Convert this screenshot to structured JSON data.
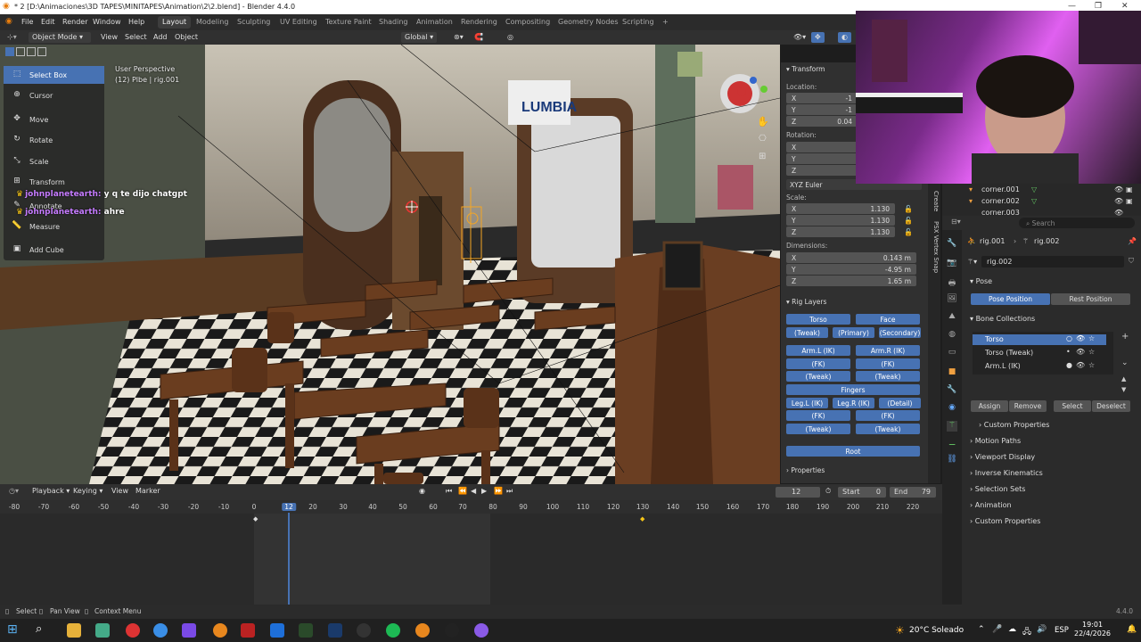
{
  "window": {
    "title": "* 2 [D:\\Animaciones\\3D TAPES\\MINITAPES\\Animation\\2\\2.blend] - Blender 4.4.0"
  },
  "menu": [
    "File",
    "Edit",
    "Render",
    "Window",
    "Help"
  ],
  "workspaces": [
    "Layout",
    "Modeling",
    "Sculpting",
    "UV Editing",
    "Texture Paint",
    "Shading",
    "Animation",
    "Rendering",
    "Compositing",
    "Geometry Nodes",
    "Scripting"
  ],
  "viewport_header": {
    "mode": "Object Mode",
    "view": "View",
    "select": "Select",
    "add": "Add",
    "object": "Object",
    "orientation": "Global"
  },
  "viewport_info": {
    "perspective": "User Perspective",
    "object": "(12) Plbe | rig.001"
  },
  "tools": [
    "Select Box",
    "Cursor",
    "Move",
    "Rotate",
    "Scale",
    "Transform",
    "Annotate",
    "Measure",
    "Add Cube"
  ],
  "chat": [
    {
      "user": "johnplanetearth:",
      "msg": "y q te dijo chatgpt"
    },
    {
      "user": "johnplanetearth:",
      "msg": "ahre"
    }
  ],
  "transform": {
    "title": "Transform",
    "location": "Location:",
    "rotation": "Rotation:",
    "euler": "XYZ Euler",
    "scale": "Scale:",
    "dimensions": "Dimensions:",
    "loc_vals": [
      "-1",
      "-1",
      "0.04"
    ],
    "scale_vals": [
      "1.130",
      "1.130",
      "1.130"
    ],
    "dim_vals": [
      "0.143 m",
      "-4.95 m",
      "1.65 m"
    ],
    "axes": [
      "X",
      "Y",
      "Z"
    ]
  },
  "rig_layers": {
    "title": "Rig Layers",
    "rows": [
      [
        "Torso",
        "Face"
      ],
      [
        "(Tweak)",
        "(Primary)",
        "(Secondary)"
      ],
      [
        "Arm.L (IK)",
        "Arm.R (IK)"
      ],
      [
        "(FK)",
        "(FK)"
      ],
      [
        "(Tweak)",
        "(Tweak)"
      ],
      [
        "Fingers"
      ],
      [
        "Leg.L (IK)",
        "Leg.R (IK)",
        "(Detail)"
      ],
      [
        "(FK)",
        "(FK)"
      ],
      [
        "(Tweak)",
        "(Tweak)"
      ],
      [
        "Root"
      ]
    ],
    "properties": "Properties"
  },
  "side_tabs": [
    "Create",
    "PSX Vertex Snap"
  ],
  "outliner": [
    "corner.001",
    "corner.002",
    "corner.003"
  ],
  "props": {
    "search": "Search",
    "path1": "rig.001",
    "path2": "rig.002",
    "name": "rig.002",
    "pose": "Pose",
    "pose_position": "Pose Position",
    "rest_position": "Rest Position",
    "bone_collections": "Bone Collections",
    "collections": [
      "Torso",
      "Torso (Tweak)",
      "Arm.L (IK)"
    ],
    "assign": "Assign",
    "remove": "Remove",
    "select": "Select",
    "deselect": "Deselect",
    "custom_properties_sub": "Custom Properties",
    "sections": [
      "Motion Paths",
      "Viewport Display",
      "Inverse Kinematics",
      "Selection Sets",
      "Animation",
      "Custom Properties"
    ]
  },
  "timeline": {
    "playback": "Playback",
    "keying": "Keying",
    "view": "View",
    "marker": "Marker",
    "current": "12",
    "start_label": "Start",
    "start": "0",
    "end_label": "End",
    "end": "79",
    "ticks": [
      "-80",
      "-70",
      "-60",
      "-50",
      "-40",
      "-30",
      "-20",
      "-10",
      "0",
      "12",
      "20",
      "30",
      "40",
      "50",
      "60",
      "70",
      "80",
      "90",
      "100",
      "110",
      "120",
      "130",
      "140",
      "150",
      "160",
      "170",
      "180",
      "190",
      "200",
      "210",
      "220"
    ]
  },
  "status": {
    "select": "Select",
    "pan": "Pan View",
    "context": "Context Menu",
    "version": "4.4.0"
  },
  "taskbar": {
    "weather": "20°C Soleado",
    "lang": "ESP",
    "time": "19:01",
    "date": "22/4/2026"
  }
}
